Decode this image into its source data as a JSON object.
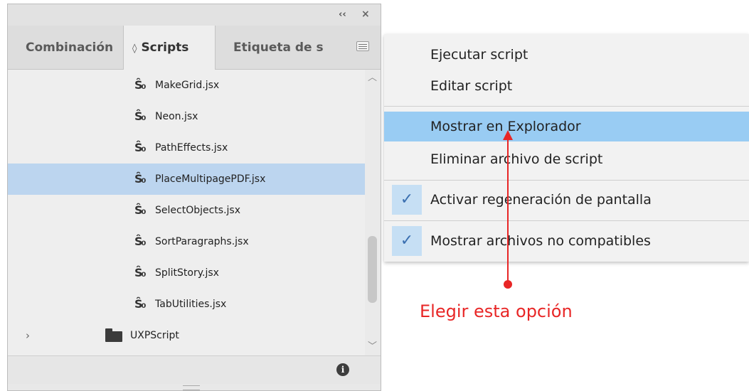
{
  "panel": {
    "tabs": [
      {
        "label": "Combinación"
      },
      {
        "label": "Scripts",
        "icon": "sort-icon"
      },
      {
        "label": "Etiqueta de s"
      }
    ],
    "collapse_glyph": "‹‹",
    "close_glyph": "×",
    "scripts": [
      {
        "name": "MakeGrid.jsx"
      },
      {
        "name": "Neon.jsx"
      },
      {
        "name": "PathEffects.jsx"
      },
      {
        "name": "PlaceMultipagePDF.jsx",
        "selected": true
      },
      {
        "name": "SelectObjects.jsx"
      },
      {
        "name": "SortParagraphs.jsx"
      },
      {
        "name": "SplitStory.jsx"
      },
      {
        "name": "TabUtilities.jsx"
      }
    ],
    "folder": {
      "name": "UXPScript",
      "icon": "folder-icon"
    },
    "info_glyph": "i"
  },
  "context_menu": {
    "items": [
      {
        "label": "Ejecutar script"
      },
      {
        "label": "Editar script"
      },
      {
        "label": "Mostrar en Explorador",
        "highlighted": true
      },
      {
        "label": "Eliminar archivo de script"
      },
      {
        "label": "Activar regeneración de pantalla",
        "checked": true
      },
      {
        "label": "Mostrar archivos no compatibles",
        "checked": true
      }
    ]
  },
  "annotation": {
    "text": "Elegir esta opción",
    "color": "#e82626"
  },
  "colors": {
    "selection": "#bcd5ef",
    "menu_highlight": "#99ccf3"
  }
}
